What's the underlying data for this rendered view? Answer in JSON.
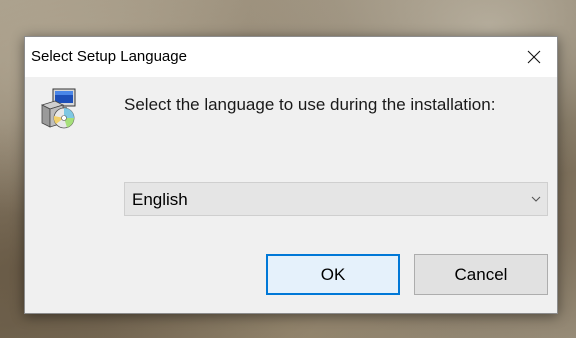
{
  "window": {
    "title": "Select Setup Language",
    "close_icon": "close-icon"
  },
  "app_icon": "setup-installer-icon",
  "prompt": {
    "text": "Select the language to use during the installation:"
  },
  "language_select": {
    "selected": "English",
    "icon": "chevron-down-icon"
  },
  "buttons": {
    "ok_label": "OK",
    "cancel_label": "Cancel"
  },
  "colors": {
    "dialog_bg": "#f0f0f0",
    "titlebar_bg": "#ffffff",
    "accent_focus": "#0078d7",
    "ok_bg": "#e5f1fb",
    "cancel_bg": "#e1e1e1",
    "select_bg": "#e5e5e5"
  }
}
